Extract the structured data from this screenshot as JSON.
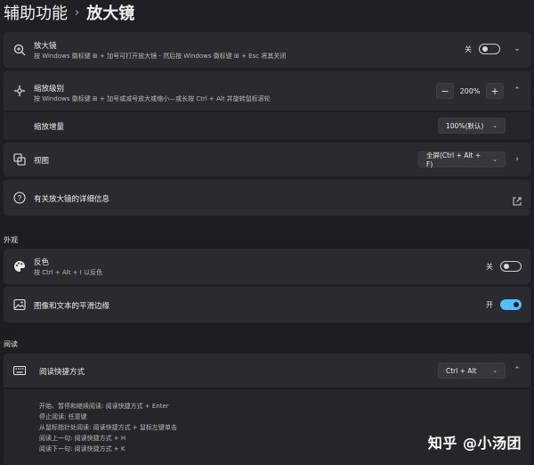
{
  "header": {
    "parent": "辅助功能",
    "separator": "›",
    "current": "放大镜"
  },
  "magnifier": {
    "title": "放大镜",
    "desc": "按 Windows 徽标键 ⊞ + 加号可打开放大镜 - 然后按 Windows 徽标键 ⊞ + Esc 将其关闭",
    "toggle_label": "关",
    "toggle_on": false,
    "icon": "zoom-in-icon"
  },
  "zoom_level": {
    "title": "缩放级别",
    "desc": "按 Windows 徽标键 ⊞ + 加号或减号放大或缩小—或长按 Ctrl + Alt 并旋转鼠标滚轮",
    "minus": "−",
    "value": "200%",
    "plus": "+",
    "icon": "move-icon"
  },
  "zoom_increment": {
    "title": "缩放增量",
    "value": "100%(默认)"
  },
  "view": {
    "title": "视图",
    "value": "全屏(Ctrl + Alt + F)",
    "icon": "view-icon"
  },
  "more_info": {
    "title": "有关放大镜的详细信息",
    "icon": "help-icon"
  },
  "appearance_label": "外观",
  "invert": {
    "title": "反色",
    "desc": "按 Ctrl + Alt + I 以反色",
    "toggle_label": "关",
    "toggle_on": false,
    "icon": "palette-icon"
  },
  "smooth_edges": {
    "title": "图像和文本的平滑边缘",
    "toggle_label": "开",
    "toggle_on": true,
    "icon": "image-icon"
  },
  "reading_label": "阅读",
  "reading_shortcut": {
    "title": "阅读快捷方式",
    "value": "Ctrl + Alt",
    "icon": "keyboard-icon",
    "lines": [
      "开始、暂停和继续阅读: 阅读快捷方式 + Enter",
      "停止阅读: 任意键",
      "从鼠标指针处阅读: 阅读快捷方式 + 鼠标左键单击",
      "阅读上一句: 阅读快捷方式 + H",
      "阅读下一句: 阅读快捷方式 + K"
    ]
  },
  "watermark": "知乎 @小汤团",
  "colors": {
    "background": "#1c1b1f",
    "card": "#2b2a2e",
    "accent": "#4cc2ff"
  }
}
